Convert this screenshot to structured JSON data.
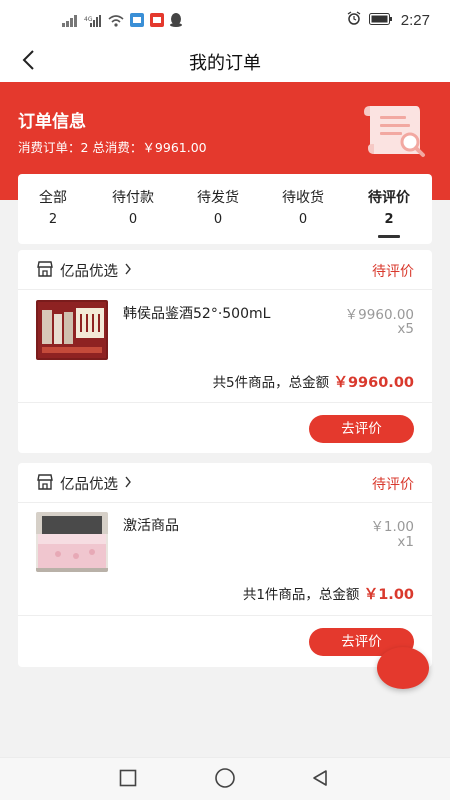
{
  "status_bar": {
    "signal_icons": [
      "signal-icon",
      "signal-4g-icon",
      "wifi-icon",
      "app-notification-icon",
      "app-notification-icon",
      "qq-icon"
    ],
    "alarm_icon": "alarm-icon",
    "battery_icon": "battery-icon",
    "time": "2:27"
  },
  "nav": {
    "back_icon": "back-arrow-icon",
    "title": "我的订单"
  },
  "header": {
    "title": "订单信息",
    "summary": "消费订单：2 总消费：￥9961.00",
    "illustration_icon": "scroll-search-icon"
  },
  "tabs": [
    {
      "label": "全部",
      "count": "2"
    },
    {
      "label": "待付款",
      "count": "0"
    },
    {
      "label": "待发货",
      "count": "0"
    },
    {
      "label": "待收货",
      "count": "0"
    },
    {
      "label": "待评价",
      "count": "2",
      "active": true
    }
  ],
  "orders": [
    {
      "shop_name": "亿品优选",
      "status": "待评价",
      "product_name": "韩侯品鉴酒52°·500mL",
      "price": "￥9960.00",
      "quantity": "x5",
      "total_prefix": "共5件商品，总金额",
      "total_amount": "￥9960.00",
      "action_label": "去评价"
    },
    {
      "shop_name": "亿品优选",
      "status": "待评价",
      "product_name": "激活商品",
      "price": "￥1.00",
      "quantity": "x1",
      "total_prefix": "共1件商品，总金额",
      "total_amount": "￥1.00",
      "action_label": "去评价"
    }
  ],
  "colors": {
    "brand_red": "#e4392d",
    "price_grey": "#999999",
    "background": "#f2f2f2"
  },
  "bottom_nav": [
    "recent-apps-icon",
    "home-icon",
    "back-icon"
  ]
}
